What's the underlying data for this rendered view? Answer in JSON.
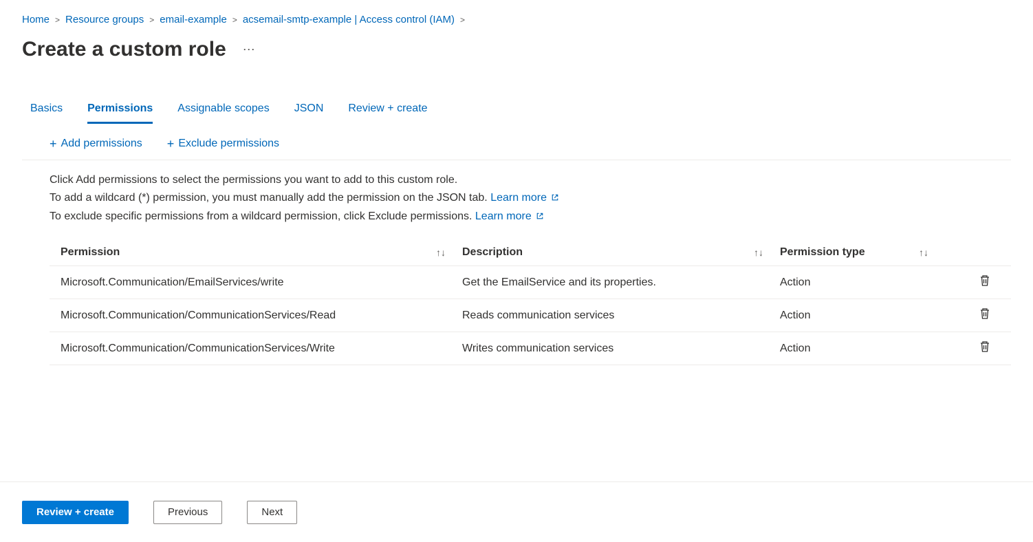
{
  "breadcrumb": {
    "items": [
      {
        "label": "Home"
      },
      {
        "label": "Resource groups"
      },
      {
        "label": "email-example"
      },
      {
        "label": "acsemail-smtp-example | Access control (IAM)"
      }
    ]
  },
  "page": {
    "title": "Create a custom role"
  },
  "tabs": {
    "items": [
      {
        "label": "Basics",
        "active": false
      },
      {
        "label": "Permissions",
        "active": true
      },
      {
        "label": "Assignable scopes",
        "active": false
      },
      {
        "label": "JSON",
        "active": false
      },
      {
        "label": "Review + create",
        "active": false
      }
    ]
  },
  "actions": {
    "add": "Add permissions",
    "exclude": "Exclude permissions"
  },
  "help": {
    "line1": "Click Add permissions to select the permissions you want to add to this custom role.",
    "line2a": "To add a wildcard (*) permission, you must manually add the permission on the JSON tab. ",
    "line3a": "To exclude specific permissions from a wildcard permission, click Exclude permissions. ",
    "learn_more": "Learn more"
  },
  "table": {
    "headers": {
      "permission": "Permission",
      "description": "Description",
      "type": "Permission type"
    },
    "rows": [
      {
        "permission": "Microsoft.Communication/EmailServices/write",
        "description": "Get the EmailService and its properties.",
        "type": "Action"
      },
      {
        "permission": "Microsoft.Communication/CommunicationServices/Read",
        "description": "Reads communication services",
        "type": "Action"
      },
      {
        "permission": "Microsoft.Communication/CommunicationServices/Write",
        "description": "Writes communication services",
        "type": "Action"
      }
    ]
  },
  "footer": {
    "review": "Review + create",
    "previous": "Previous",
    "next": "Next"
  }
}
